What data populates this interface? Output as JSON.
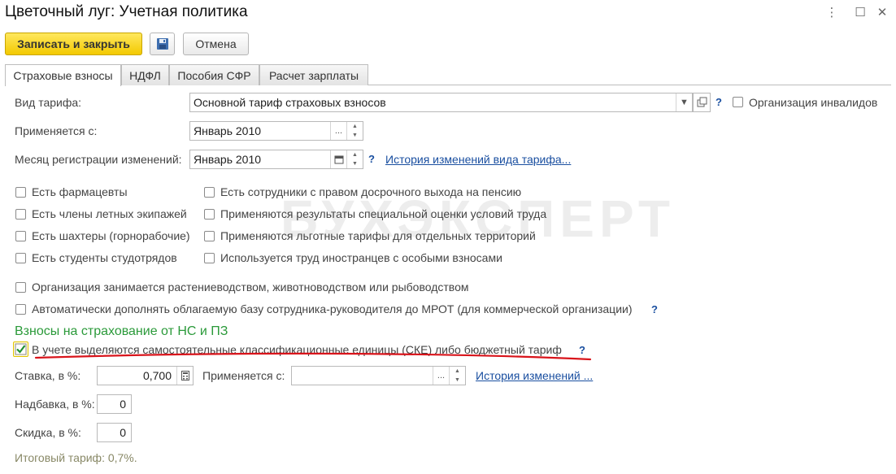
{
  "window": {
    "title": "Цветочный луг: Учетная политика",
    "more_glyph": "⋮",
    "maximize_glyph": "☐",
    "close_glyph": "✕"
  },
  "toolbar": {
    "save_close_label": "Записать и закрыть",
    "cancel_label": "Отмена"
  },
  "tabs": [
    {
      "label": "Страховые взносы",
      "active": true
    },
    {
      "label": "НДФЛ",
      "active": false
    },
    {
      "label": "Пособия СФР",
      "active": false
    },
    {
      "label": "Расчет зарплаты",
      "active": false
    }
  ],
  "form": {
    "tariff_label": "Вид тарифа:",
    "tariff_value": "Основной тариф страховых взносов",
    "disabled_org_label": "Организация инвалидов",
    "applied_from_label": "Применяется с:",
    "applied_from_value": "Январь 2010",
    "reg_month_label": "Месяц регистрации изменений:",
    "reg_month_value": "Январь 2010",
    "history_tariff_link": "История изменений вида тарифа...",
    "help_mark": "?",
    "ellipsis": "...",
    "checks_left": [
      "Есть фармацевты",
      "Есть члены летных экипажей",
      "Есть шахтеры (горнорабочие)",
      "Есть студенты студотрядов"
    ],
    "checks_right": [
      "Есть сотрудники с правом досрочного выхода на пенсию",
      "Применяются результаты специальной оценки условий труда",
      "Применяются льготные тарифы для отдельных территорий",
      "Используется труд иностранцев с особыми взносами"
    ],
    "check_agri": "Организация занимается растениеводством, животноводством или рыбоводством",
    "check_mrot": "Автоматически дополнять облагаемую базу сотрудника-руководителя до МРОТ (для коммерческой организации)"
  },
  "ns_section": {
    "title": "Взносы на страхование от НС и ПЗ",
    "ske_label": "В учете выделяются самостоятельные классификационные единицы (СКЕ) либо бюджетный тариф",
    "ske_checked": true,
    "rate_label": "Ставка, в %:",
    "rate_value": "0,700",
    "applied_label": "Применяется с:",
    "applied_value": "",
    "history_link": "История изменений ...",
    "surcharge_label": "Надбавка, в %:",
    "surcharge_value": "0",
    "discount_label": "Скидка, в %:",
    "discount_value": "0",
    "total_text": "Итоговый тариф: 0,7%."
  },
  "watermark": "БУХЭКСПЕРТ",
  "colors": {
    "primary_button": "#f3c900",
    "section_title": "#2b9a3a",
    "link": "#1a4fa0",
    "annotation_underline": "#d9141b"
  }
}
